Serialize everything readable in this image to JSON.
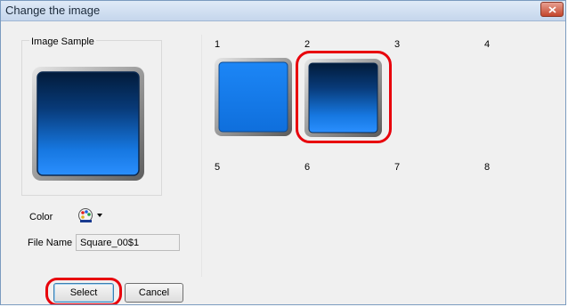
{
  "window": {
    "title": "Change the image"
  },
  "sample": {
    "label": "Image Sample"
  },
  "fields": {
    "color_label": "Color",
    "color_icon": "palette-icon",
    "filename_label": "File Name",
    "filename_value": "Square_00$1"
  },
  "buttons": {
    "select": "Select",
    "cancel": "Cancel"
  },
  "grid": {
    "numbers": [
      "1",
      "2",
      "3",
      "4",
      "5",
      "6",
      "7",
      "8"
    ],
    "selected": "2"
  },
  "colors": {
    "accent": "#e8000b",
    "tile_blue": "#1a7ff0",
    "tile_dark": "#062a55"
  }
}
